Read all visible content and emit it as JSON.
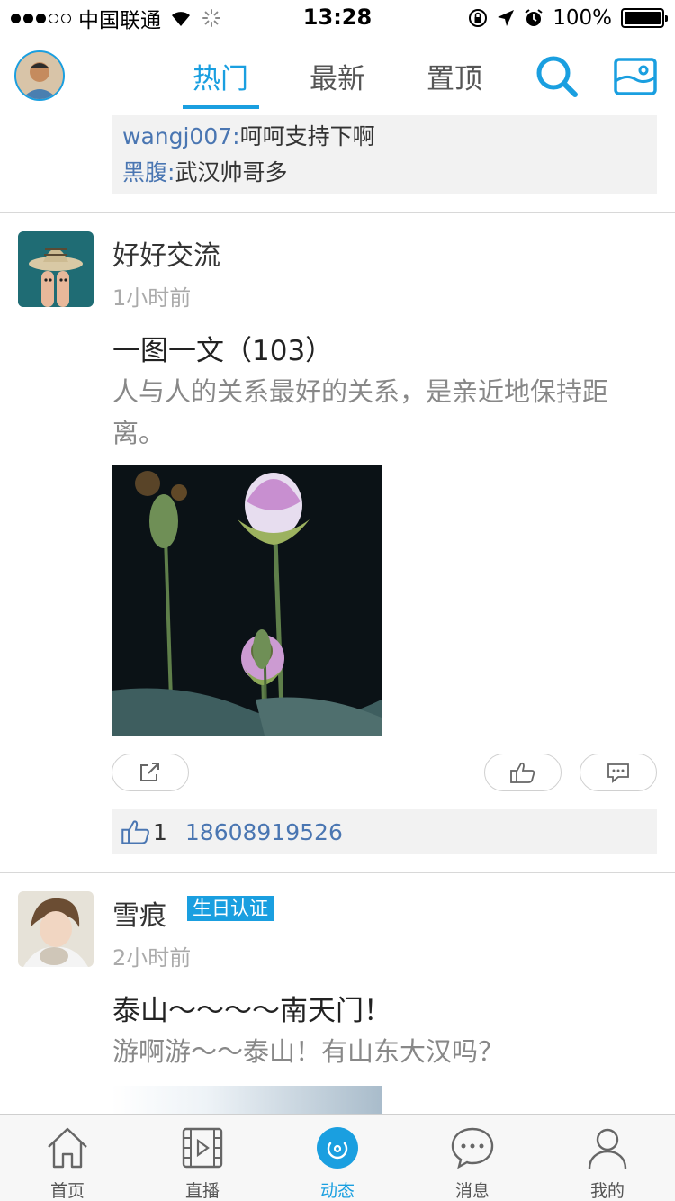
{
  "status_bar": {
    "carrier": "中国联通",
    "time": "13:28",
    "battery": "100%"
  },
  "header": {
    "tabs": [
      {
        "label": "热门",
        "active": true
      },
      {
        "label": "最新",
        "active": false
      },
      {
        "label": "置顶",
        "active": false
      }
    ],
    "search_icon": "search-icon",
    "photo_icon": "photo-icon"
  },
  "comments": [
    {
      "user": "wangj007:",
      "text": "呵呵支持下啊"
    },
    {
      "user": "黑腹:",
      "text": "武汉帅哥多"
    }
  ],
  "posts": [
    {
      "name": "好好交流",
      "time": "1小时前",
      "title": "一图一文（103）",
      "body": "人与人的关系最好的关系，是亲近地保持距离。",
      "likes_count": "1",
      "liked_by": "18608919526"
    },
    {
      "name": "雪痕",
      "badge": "生日认证",
      "time": "2小时前",
      "title": "泰山～～～～南天门！",
      "body": "游啊游～～泰山！有山东大汉吗？"
    }
  ],
  "tabbar": [
    {
      "label": "首页",
      "icon": "home-icon",
      "active": false
    },
    {
      "label": "直播",
      "icon": "video-icon",
      "active": false
    },
    {
      "label": "动态",
      "icon": "moments-icon",
      "active": true
    },
    {
      "label": "消息",
      "icon": "message-icon",
      "active": false
    },
    {
      "label": "我的",
      "icon": "profile-icon",
      "active": false
    }
  ],
  "colors": {
    "accent": "#1a9fe0",
    "username_link": "#4a76b2",
    "muted_text": "#888888"
  }
}
